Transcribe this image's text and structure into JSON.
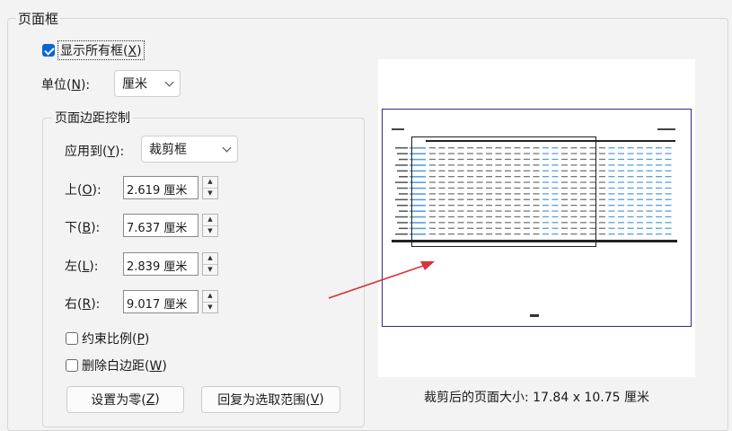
{
  "group_title": "页面框",
  "show_all": {
    "label_pre": "显示所有框(",
    "key": "X",
    "label_post": ")",
    "checked": true
  },
  "unit": {
    "label_pre": "单位(",
    "key": "N",
    "label_post": "):",
    "value": "厘米"
  },
  "margin_group": {
    "title": "页面边距控制",
    "apply": {
      "label_pre": "应用到(",
      "key": "Y",
      "label_post": "):",
      "value": "裁剪框"
    },
    "top": {
      "label_pre": "上(",
      "key": "O",
      "label_post": "):",
      "value": "2.619 厘米"
    },
    "bottom": {
      "label_pre": "下(",
      "key": "B",
      "label_post": "):",
      "value": "7.637 厘米"
    },
    "left": {
      "label_pre": "左(",
      "key": "L",
      "label_post": "):",
      "value": "2.839 厘米"
    },
    "right": {
      "label_pre": "右(",
      "key": "R",
      "label_post": "):",
      "value": "9.017 厘米"
    },
    "constrain": {
      "label_pre": "约束比例(",
      "key": "P",
      "label_post": ")",
      "checked": false
    },
    "remove_white": {
      "label_pre": "删除白边距(",
      "key": "W",
      "label_post": ")",
      "checked": false
    },
    "zero_button": {
      "label_pre": "设置为零(",
      "key": "Z",
      "label_post": ")"
    },
    "revert_button": {
      "label_pre": "回复为选取范围(",
      "key": "V",
      "label_post": ")"
    }
  },
  "preview": {
    "size_text": "裁剪后的页面大小: 17.84 x 10.75 厘米"
  },
  "colors": {
    "accent": "#0a64d6",
    "page_border": "#2f2f7d",
    "arrow": "#d8333b",
    "table_blue": "#5aa0d8"
  },
  "icons": {
    "checkbox": "check-icon",
    "dropdown": "chevron-down-icon",
    "spinner": "spinner-arrows-icon"
  }
}
